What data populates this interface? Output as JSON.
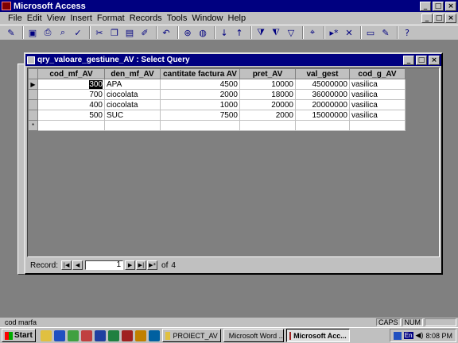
{
  "app": {
    "title": "Microsoft Access",
    "window_buttons": [
      "_",
      "□",
      "×"
    ]
  },
  "menu": {
    "items": [
      "File",
      "Edit",
      "View",
      "Insert",
      "Format",
      "Records",
      "Tools",
      "Window",
      "Help"
    ]
  },
  "query_window": {
    "title": "qry_valoare_gestiune_AV : Select Query",
    "columns": [
      "cod_mf_AV",
      "den_mf_AV",
      "cantitate factura AV",
      "pret_AV",
      "val_gest",
      "cod_g_AV"
    ],
    "rows": [
      [
        "300",
        "APA",
        "4500",
        "10000",
        "45000000",
        "vasilica"
      ],
      [
        "700",
        "ciocolata",
        "2000",
        "18000",
        "36000000",
        "vasilica"
      ],
      [
        "400",
        "ciocolata",
        "1000",
        "20000",
        "20000000",
        "vasilica"
      ],
      [
        "500",
        "SUC",
        "7500",
        "2000",
        "15000000",
        "vasilica"
      ]
    ],
    "new_row_marker": "*",
    "current_row_marker": "▶",
    "nav": {
      "label": "Record:",
      "current": "1",
      "of_label": "of",
      "total": "4"
    }
  },
  "statusbar": {
    "message": "cod marfa",
    "indicators": [
      "CAPS",
      "NUM"
    ]
  },
  "taskbar": {
    "start_label": "Start",
    "tasks": [
      {
        "label": "PROIECT_AV",
        "active": false
      },
      {
        "label": "Microsoft Word ...",
        "active": false
      },
      {
        "label": "Microsoft Acc...",
        "active": true
      }
    ],
    "tray": {
      "lang": "En",
      "time": "8:08 PM"
    }
  }
}
